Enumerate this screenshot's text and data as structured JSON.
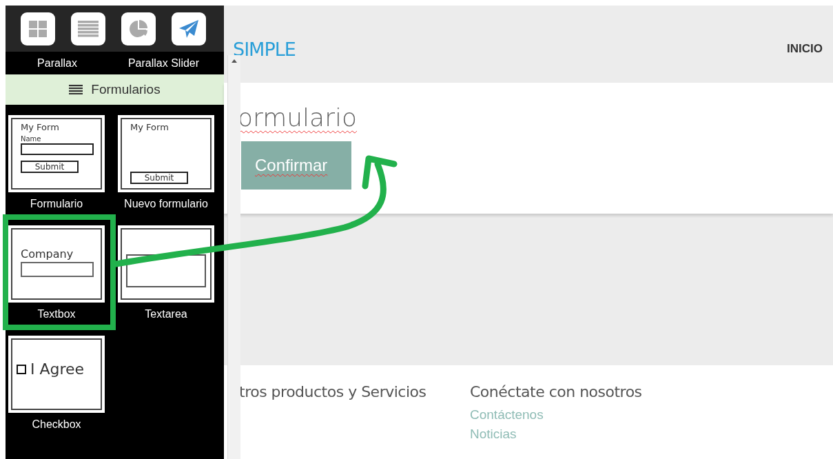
{
  "toolbar": {
    "buttons": [
      {
        "kind": "grid"
      },
      {
        "kind": "list"
      },
      {
        "kind": "pie"
      },
      {
        "kind": "send"
      }
    ]
  },
  "widgets_above": [
    "Parallax",
    "Parallax Slider"
  ],
  "section": {
    "title": "Formularios"
  },
  "widgets": [
    {
      "kind": "form",
      "label": "Formulario",
      "highlighted": false,
      "preview": {
        "title": "My Form",
        "field_label": "Name",
        "button": "Submit"
      }
    },
    {
      "kind": "form",
      "label": "Nuevo formulario",
      "highlighted": false,
      "preview": {
        "title": "My Form",
        "button": "Submit"
      }
    },
    {
      "kind": "textbox",
      "label": "Textbox",
      "highlighted": true,
      "preview": {
        "field_label": "Company"
      }
    },
    {
      "kind": "textarea",
      "label": "Textarea",
      "highlighted": false
    },
    {
      "kind": "checkbox",
      "label": "Checkbox",
      "highlighted": false,
      "preview": {
        "field_label": "I Agree",
        "checked": false
      }
    }
  ],
  "site": {
    "logo": "SIMPLE",
    "nav": [
      "INICIO"
    ],
    "heading": "ormulario",
    "button": "Confirmar",
    "footer": [
      {
        "title": "tros productos y Servicios"
      },
      {
        "title": "Conéctate con nosotros",
        "links": [
          "Contáctenos",
          "Noticias"
        ]
      }
    ]
  }
}
